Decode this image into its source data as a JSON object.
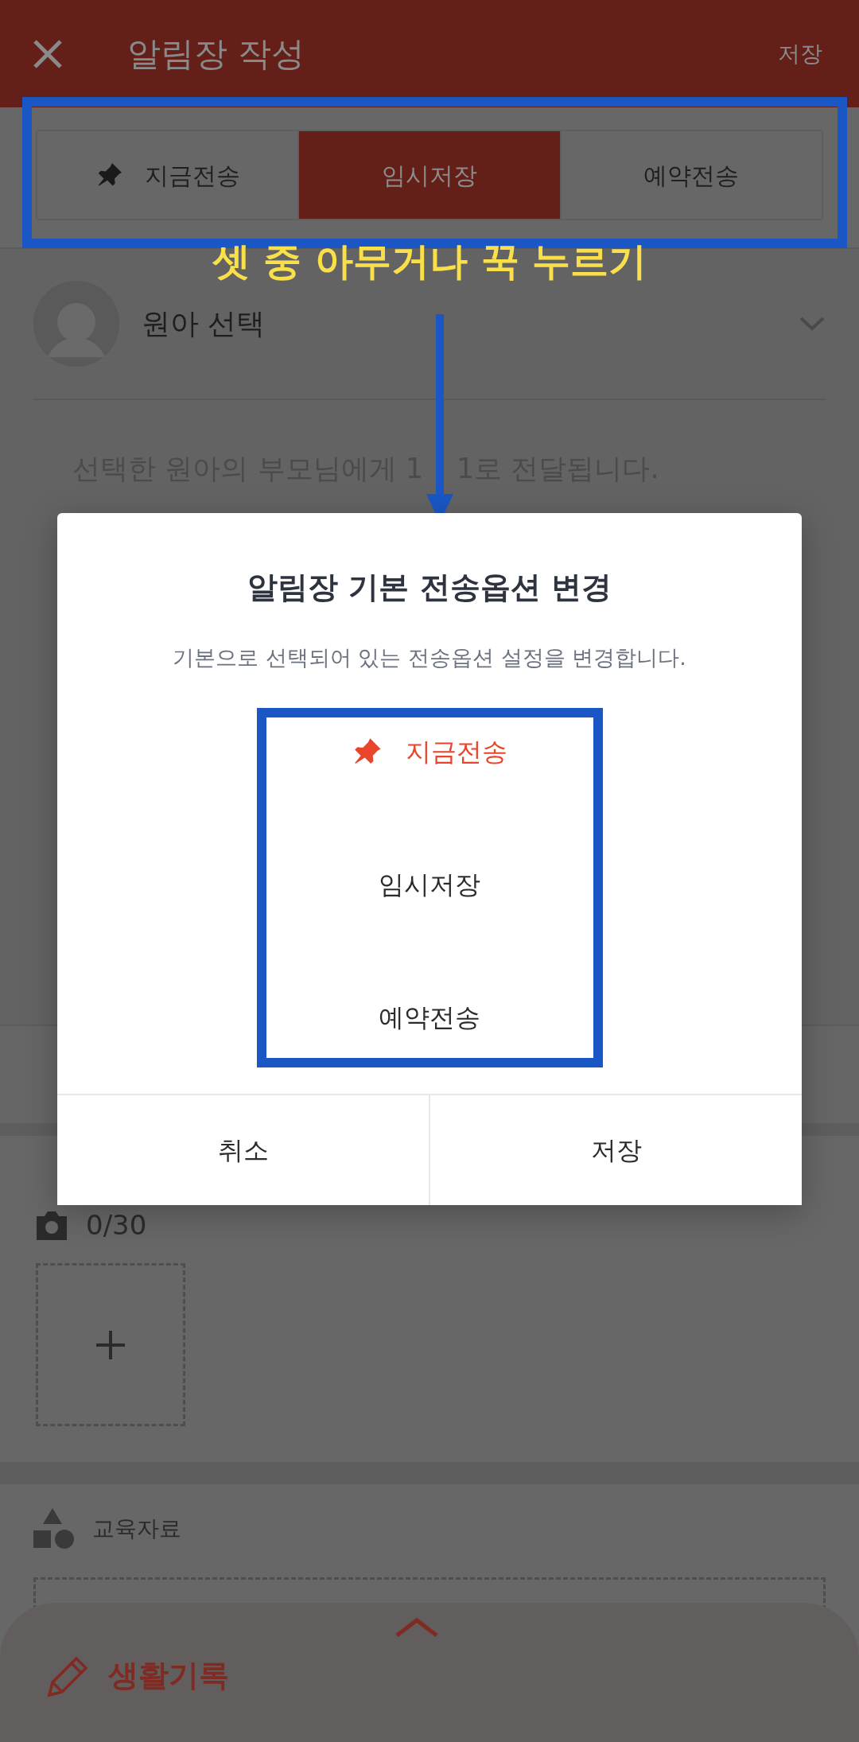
{
  "app_bar": {
    "title": "알림장 작성",
    "save": "저장"
  },
  "send_options": [
    {
      "label": "지금전송",
      "selected": false,
      "pinned": true
    },
    {
      "label": "임시저장",
      "selected": true,
      "pinned": false
    },
    {
      "label": "예약전송",
      "selected": false,
      "pinned": false
    }
  ],
  "annotation": {
    "text": "셋 중 아무거나 꾹 누르기"
  },
  "child_select": {
    "label": "원아 선택"
  },
  "notice": [
    "선택한 원아의 부모님에게 1",
    "1로 전달됩니다."
  ],
  "photos": {
    "count": "0/30"
  },
  "materials": {
    "label": "교육자료"
  },
  "bottom_sheet": {
    "label": "생활기록"
  },
  "dialog": {
    "title": "알림장 기본 전송옵션 변경",
    "message": "기본으로 선택되어 있는 전송옵션 설정을 변경합니다.",
    "options": [
      {
        "label": "지금전송",
        "pinned": true
      },
      {
        "label": "임시저장",
        "pinned": false
      },
      {
        "label": "예약전송",
        "pinned": false
      }
    ],
    "buttons": [
      "취소",
      "저장"
    ]
  }
}
